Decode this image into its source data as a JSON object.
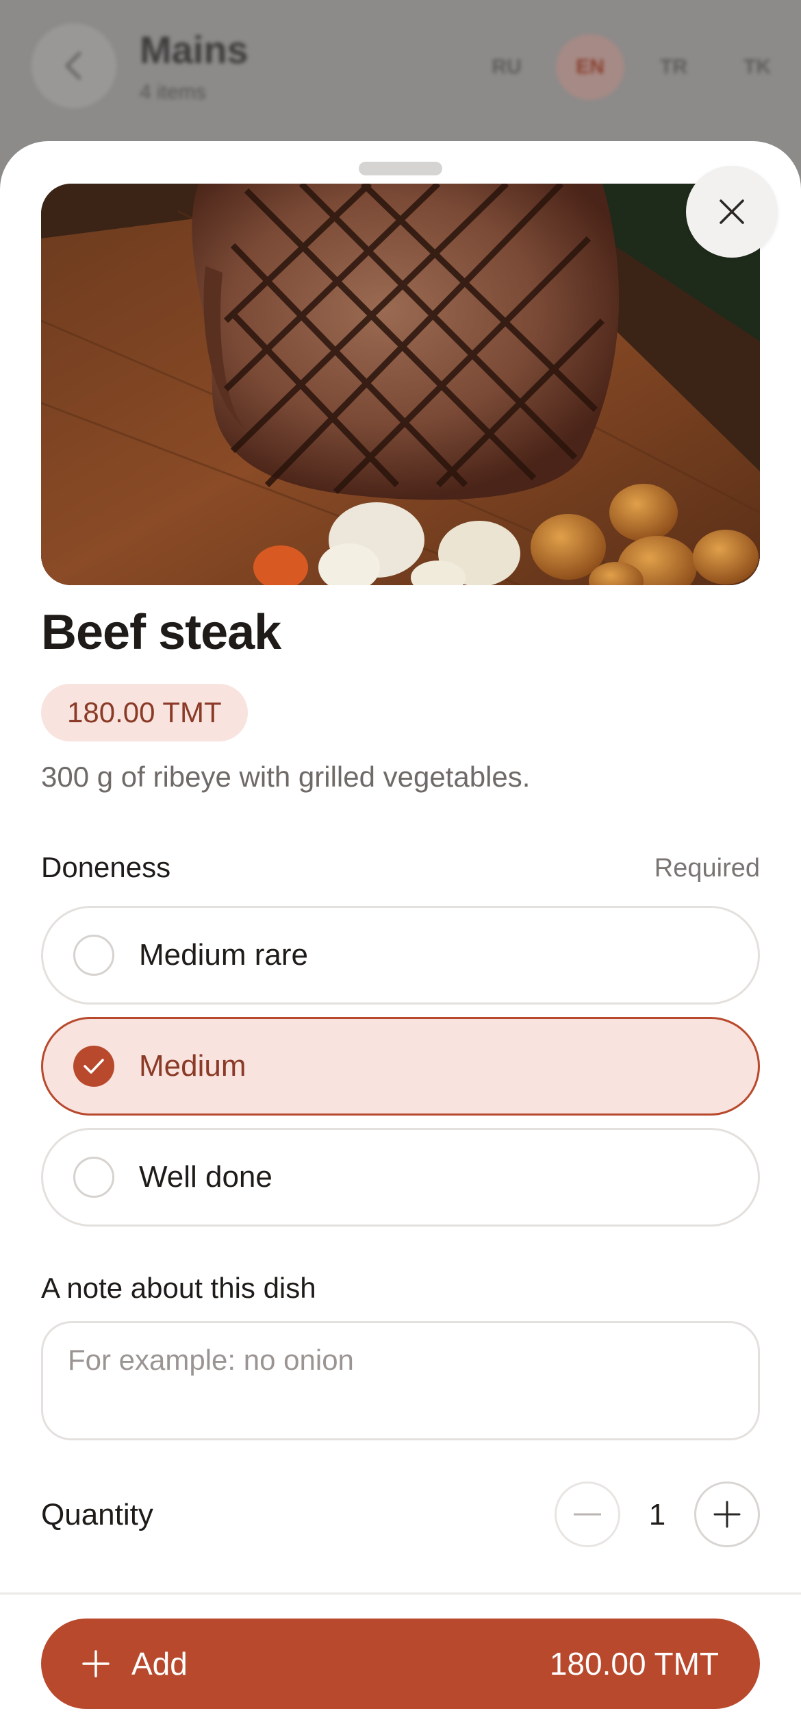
{
  "background": {
    "title": "Mains",
    "subtitle": "4 items",
    "languages": [
      "RU",
      "EN",
      "TR",
      "TK"
    ],
    "active_language": "EN"
  },
  "dish": {
    "title": "Beef steak",
    "price": "180.00 TMT",
    "description": "300 g of ribeye with grilled vegetables."
  },
  "doneness": {
    "label": "Doneness",
    "required_label": "Required",
    "options": [
      {
        "label": "Medium rare",
        "selected": false
      },
      {
        "label": "Medium",
        "selected": true
      },
      {
        "label": "Well done",
        "selected": false
      }
    ]
  },
  "note": {
    "label": "A note about this dish",
    "placeholder": "For example: no onion",
    "value": ""
  },
  "quantity": {
    "label": "Quantity",
    "value": "1"
  },
  "footer": {
    "add_label": "Add",
    "total": "180.00 TMT"
  },
  "colors": {
    "accent": "#b8492c",
    "accent_soft": "#f8e3df",
    "accent_text": "#8a3a26"
  },
  "icons": {
    "close": "close-icon",
    "back": "chevron-left-icon",
    "minus": "minus-icon",
    "plus": "plus-icon",
    "check": "check-icon"
  }
}
